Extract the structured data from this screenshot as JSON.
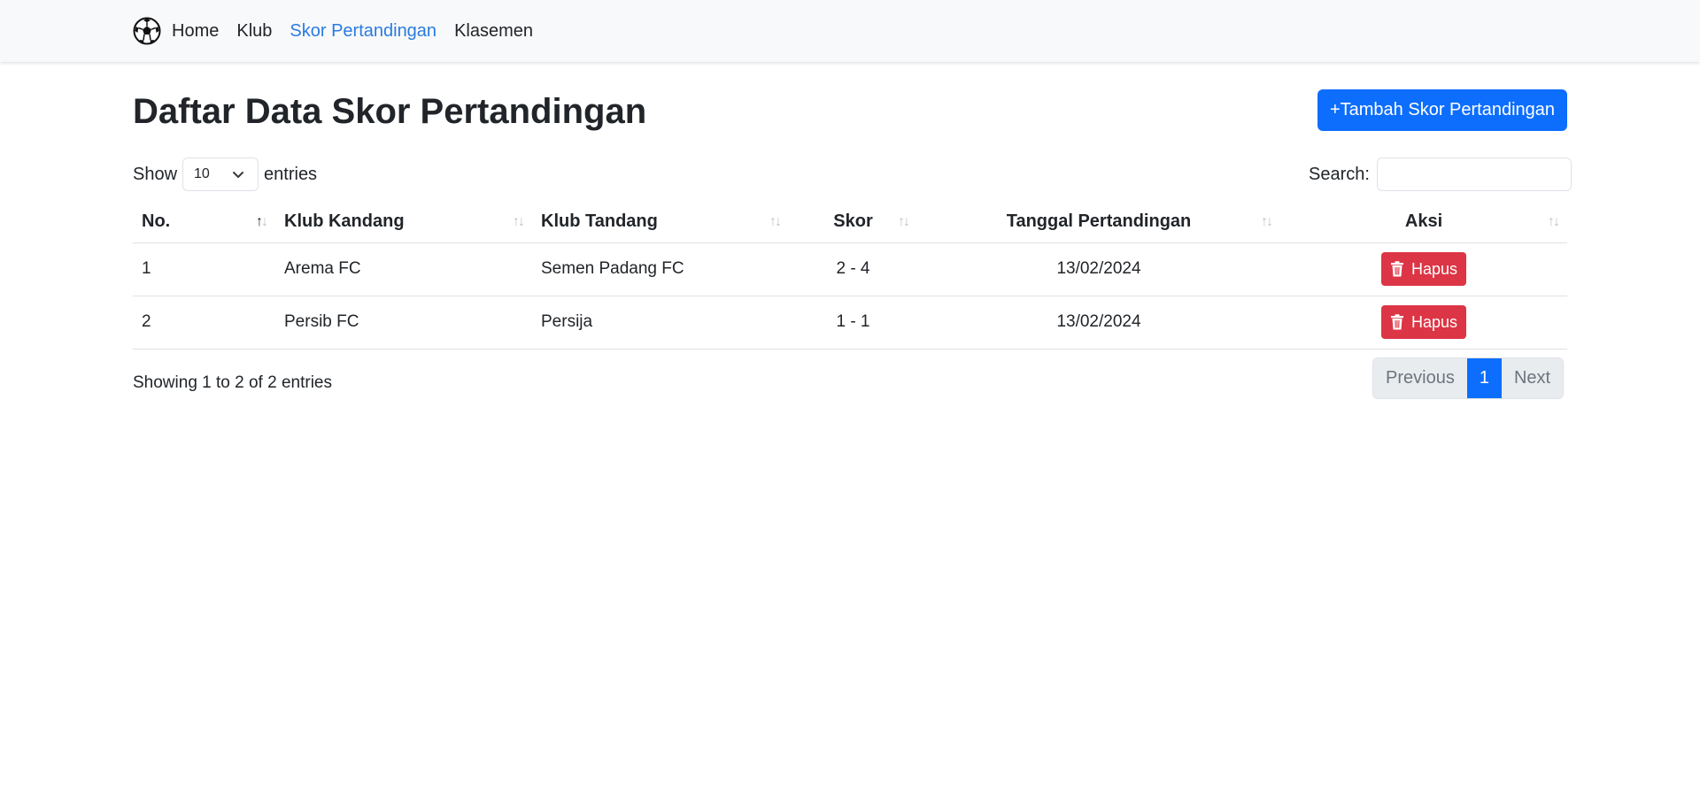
{
  "nav": {
    "logo": "soccer-ball-icon",
    "links": [
      {
        "label": "Home"
      },
      {
        "label": "Klub"
      },
      {
        "label": "Skor Pertandingan",
        "active": true
      },
      {
        "label": "Klasemen"
      }
    ]
  },
  "page": {
    "title": "Daftar Data Skor Pertandingan",
    "add_button": "+Tambah Skor Pertandingan"
  },
  "controls": {
    "show_label": "Show",
    "entries_value": "10",
    "entries_label": "entries",
    "search_label": "Search:",
    "search_value": ""
  },
  "table": {
    "headers": [
      "No.",
      "Klub Kandang",
      "Klub Tandang",
      "Skor",
      "Tanggal Pertandingan",
      "Aksi"
    ],
    "rows": [
      {
        "no": "1",
        "home": "Arema FC",
        "away": "Semen Padang FC",
        "score": "2 - 4",
        "date": "13/02/2024",
        "action": "Hapus"
      },
      {
        "no": "2",
        "home": "Persib FC",
        "away": "Persija",
        "score": "1 - 1",
        "date": "13/02/2024",
        "action": "Hapus"
      }
    ]
  },
  "footer": {
    "info": "Showing 1 to 2 of 2 entries",
    "pagination": {
      "previous": "Previous",
      "current": "1",
      "next": "Next"
    }
  },
  "colors": {
    "primary": "#0d6efd",
    "danger": "#dc3545",
    "active_link": "#2a7bdf"
  }
}
